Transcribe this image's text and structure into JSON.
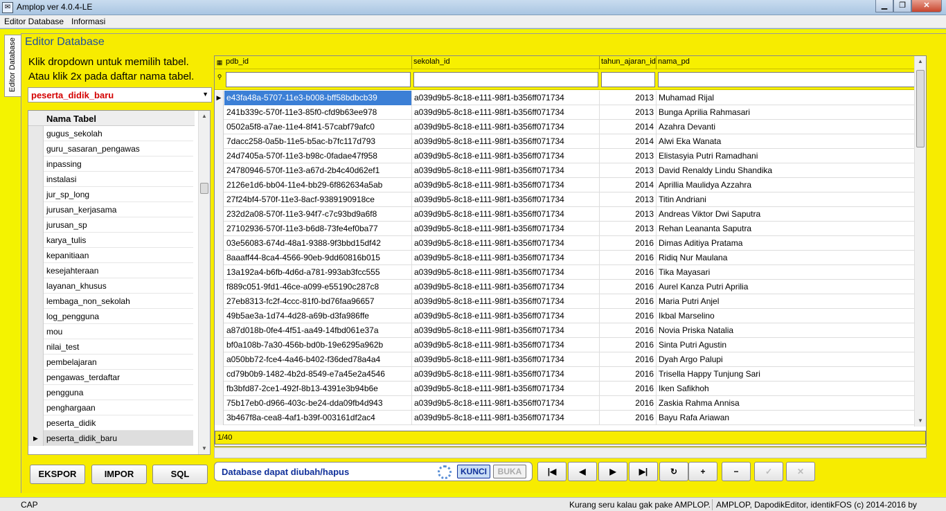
{
  "window": {
    "title": "Amplop ver 4.0.4-LE"
  },
  "menu": [
    "Editor Database",
    "Informasi"
  ],
  "side_tab": "Editor Database",
  "panel_title": "Editor Database",
  "hints": [
    "Klik dropdown untuk memilih tabel.",
    "Atau klik 2x pada daftar nama tabel."
  ],
  "dropdown": {
    "value": "peserta_didik_baru"
  },
  "table_list": {
    "header": "Nama Tabel",
    "items": [
      "gugus_sekolah",
      "guru_sasaran_pengawas",
      "inpassing",
      "instalasi",
      "jur_sp_long",
      "jurusan_kerjasama",
      "jurusan_sp",
      "karya_tulis",
      "kepanitiaan",
      "kesejahteraan",
      "layanan_khusus",
      "lembaga_non_sekolah",
      "log_pengguna",
      "mou",
      "nilai_test",
      "pembelajaran",
      "pengawas_terdaftar",
      "pengguna",
      "penghargaan",
      "peserta_didik",
      "peserta_didik_baru"
    ],
    "selected": "peserta_didik_baru"
  },
  "grid": {
    "columns": [
      "pdb_id",
      "sekolah_id",
      "tahun_ajaran_id",
      "nama_pd"
    ],
    "rows": [
      [
        "e43fa48a-5707-11e3-b008-bff58bdbcb39",
        "a039d9b5-8c18-e111-98f1-b356ff071734",
        "2013",
        "Muhamad Rijal"
      ],
      [
        "241b339c-570f-11e3-85f0-cfd9b63ee978",
        "a039d9b5-8c18-e111-98f1-b356ff071734",
        "2013",
        "Bunga Aprilia Rahmasari"
      ],
      [
        "0502a5f8-a7ae-11e4-8f41-57cabf79afc0",
        "a039d9b5-8c18-e111-98f1-b356ff071734",
        "2014",
        "Azahra Devanti"
      ],
      [
        "7dacc258-0a5b-11e5-b5ac-b7fc117d793",
        "a039d9b5-8c18-e111-98f1-b356ff071734",
        "2014",
        "Alwi Eka Wanata"
      ],
      [
        "24d7405a-570f-11e3-b98c-0fadae47f958",
        "a039d9b5-8c18-e111-98f1-b356ff071734",
        "2013",
        "Elistasyia Putri Ramadhani"
      ],
      [
        "24780946-570f-11e3-a67d-2b4c40d62ef1",
        "a039d9b5-8c18-e111-98f1-b356ff071734",
        "2013",
        "David Renaldy Lindu Shandika"
      ],
      [
        "2126e1d6-bb04-11e4-bb29-6f862634a5ab",
        "a039d9b5-8c18-e111-98f1-b356ff071734",
        "2014",
        "Aprillia  Maulidya Azzahra"
      ],
      [
        "27f24bf4-570f-11e3-8acf-9389190918ce",
        "a039d9b5-8c18-e111-98f1-b356ff071734",
        "2013",
        "Titin Andriani"
      ],
      [
        "232d2a08-570f-11e3-94f7-c7c93bd9a6f8",
        "a039d9b5-8c18-e111-98f1-b356ff071734",
        "2013",
        "Andreas Viktor Dwi Saputra"
      ],
      [
        "27102936-570f-11e3-b6d8-73fe4ef0ba77",
        "a039d9b5-8c18-e111-98f1-b356ff071734",
        "2013",
        "Rehan Leananta Saputra"
      ],
      [
        "03e56083-674d-48a1-9388-9f3bbd15df42",
        "a039d9b5-8c18-e111-98f1-b356ff071734",
        "2016",
        "Dimas Aditiya Pratama"
      ],
      [
        "8aaaff44-8ca4-4566-90eb-9dd60816b015",
        "a039d9b5-8c18-e111-98f1-b356ff071734",
        "2016",
        "Ridiq Nur Maulana"
      ],
      [
        "13a192a4-b6fb-4d6d-a781-993ab3fcc555",
        "a039d9b5-8c18-e111-98f1-b356ff071734",
        "2016",
        "Tika Mayasari"
      ],
      [
        "f889c051-9fd1-46ce-a099-e55190c287c8",
        "a039d9b5-8c18-e111-98f1-b356ff071734",
        "2016",
        "Aurel Kanza Putri Aprilia"
      ],
      [
        "27eb8313-fc2f-4ccc-81f0-bd76faa96657",
        "a039d9b5-8c18-e111-98f1-b356ff071734",
        "2016",
        "Maria Putri Anjel"
      ],
      [
        "49b5ae3a-1d74-4d28-a69b-d3fa986ffe",
        "a039d9b5-8c18-e111-98f1-b356ff071734",
        "2016",
        "Ikbal Marselino"
      ],
      [
        "a87d018b-0fe4-4f51-aa49-14fbd061e37a",
        "a039d9b5-8c18-e111-98f1-b356ff071734",
        "2016",
        "Novia Priska Natalia"
      ],
      [
        "bf0a108b-7a30-456b-bd0b-19e6295a962b",
        "a039d9b5-8c18-e111-98f1-b356ff071734",
        "2016",
        "Sinta Putri Agustin"
      ],
      [
        "a050bb72-fce4-4a46-b402-f36ded78a4a4",
        "a039d9b5-8c18-e111-98f1-b356ff071734",
        "2016",
        "Dyah Argo Palupi"
      ],
      [
        "cd79b0b9-1482-4b2d-8549-e7a45e2a4546",
        "a039d9b5-8c18-e111-98f1-b356ff071734",
        "2016",
        "Trisella Happy Tunjung Sari"
      ],
      [
        "fb3bfd87-2ce1-492f-8b13-4391e3b94b6e",
        "a039d9b5-8c18-e111-98f1-b356ff071734",
        "2016",
        "Iken Safikhoh"
      ],
      [
        "75b17eb0-d966-403c-be24-dda09fb4d943",
        "a039d9b5-8c18-e111-98f1-b356ff071734",
        "2016",
        "Zaskia Rahma Annisa"
      ],
      [
        "3b467f8a-cea8-4af1-b39f-003161df2ac4",
        "a039d9b5-8c18-e111-98f1-b356ff071734",
        "2016",
        "Bayu Rafa Ariawan"
      ]
    ],
    "record_nav": "1/40"
  },
  "buttons": {
    "export": "EKSPOR",
    "import": "IMPOR",
    "sql": "SQL"
  },
  "status": {
    "text": "Database dapat diubah/hapus",
    "lock": "KUNCI",
    "open": "BUKA"
  },
  "nav_buttons": [
    "|◀",
    "◀",
    "▶",
    "▶|",
    "↻",
    "+",
    "−",
    "✓",
    "✕"
  ],
  "statusbar": {
    "cap": "CAP",
    "tagline": "Kurang seru kalau gak pake AMPLOP.",
    "copyright": "AMPLOP, DapodikEditor, identikFOS (c) 2014-2016 by IDENTIK"
  }
}
